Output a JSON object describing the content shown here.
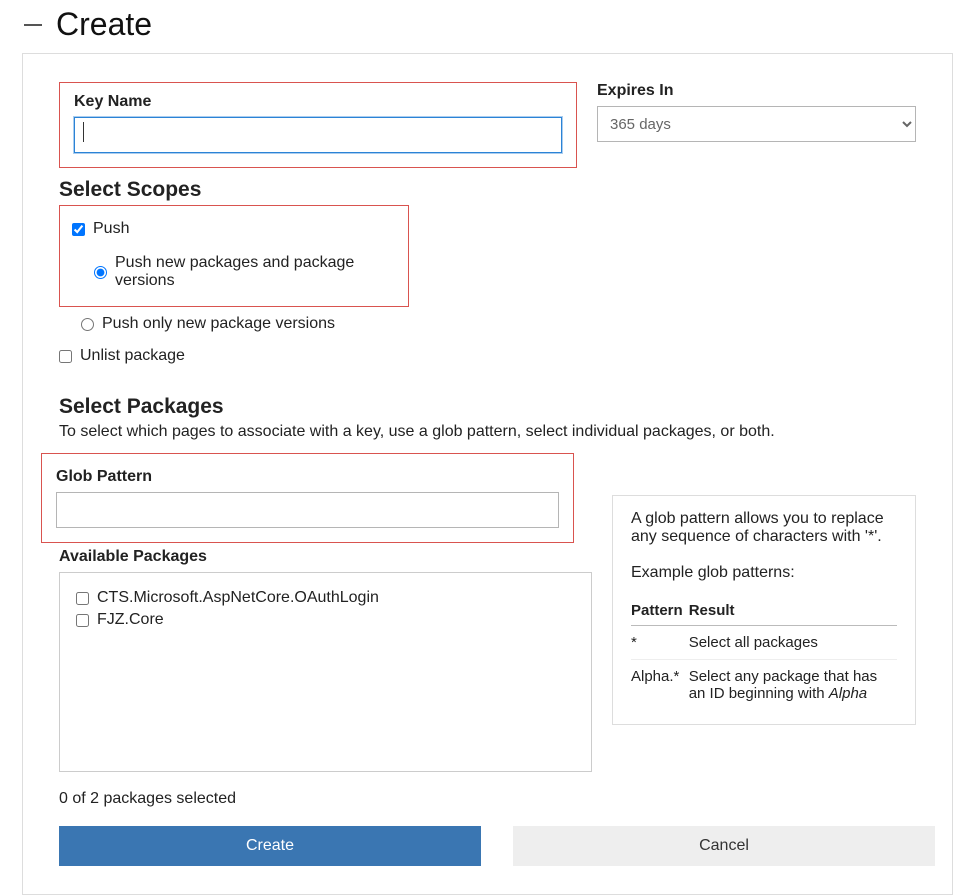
{
  "header": {
    "title": "Create"
  },
  "keyName": {
    "label": "Key Name",
    "value": ""
  },
  "expires": {
    "label": "Expires In",
    "selected": "365 days"
  },
  "scopes": {
    "heading": "Select Scopes",
    "push": {
      "label": "Push",
      "checked": true
    },
    "pushNew": {
      "label": "Push new packages and package versions",
      "checked": true
    },
    "pushOnly": {
      "label": "Push only new package versions",
      "checked": false
    },
    "unlist": {
      "label": "Unlist package",
      "checked": false
    }
  },
  "packages": {
    "heading": "Select Packages",
    "sub": "To select which pages to associate with a key, use a glob pattern, select individual packages, or both.",
    "glob": {
      "label": "Glob Pattern",
      "value": ""
    },
    "availableLabel": "Available Packages",
    "available": [
      {
        "name": "CTS.Microsoft.AspNetCore.OAuthLogin",
        "checked": false
      },
      {
        "name": "FJZ.Core",
        "checked": false
      }
    ],
    "count_text": "0 of 2 packages selected"
  },
  "help": {
    "text": "A glob pattern allows you to replace any sequence of characters with '*'.",
    "exampleLabel": "Example glob patterns:",
    "table": {
      "h1": "Pattern",
      "h2": "Result",
      "rows": [
        {
          "pattern": "*",
          "result_pre": "Select all packages",
          "result_em": ""
        },
        {
          "pattern": "Alpha.*",
          "result_pre": "Select any package that has an ID beginning with ",
          "result_em": "Alpha"
        }
      ]
    }
  },
  "buttons": {
    "create": "Create",
    "cancel": "Cancel"
  }
}
